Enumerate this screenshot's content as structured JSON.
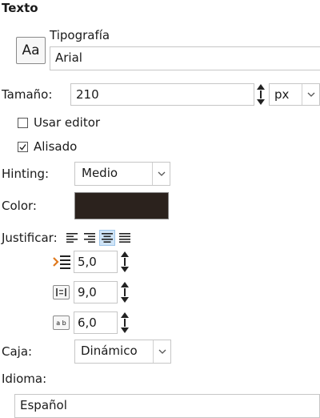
{
  "section_title": "Texto",
  "font": {
    "icon_label": "Aa",
    "label": "Tipografía",
    "value": "Arial"
  },
  "size": {
    "label": "Tamaño:",
    "value": "210",
    "unit": "px"
  },
  "use_editor": {
    "label": "Usar editor",
    "checked": false
  },
  "antialias": {
    "label": "Alisado",
    "checked": true
  },
  "hinting": {
    "label": "Hinting:",
    "value": "Medio"
  },
  "color": {
    "label": "Color:",
    "swatch": "#2b221d"
  },
  "justify": {
    "label": "Justificar:",
    "options": [
      "left",
      "right",
      "center",
      "fill"
    ],
    "selected": "center"
  },
  "indent": {
    "value": "5,0"
  },
  "line_spacing": {
    "value": "9,0"
  },
  "letter_spacing": {
    "icon_label": "a b",
    "value": "6,0"
  },
  "box": {
    "label": "Caja:",
    "value": "Dinámico"
  },
  "language": {
    "label": "Idioma:",
    "value": "Español"
  },
  "colors": {
    "accent": "#3d7fd1",
    "indent_icon": "#e07a1f",
    "active_bg": "#cfe4f7"
  }
}
